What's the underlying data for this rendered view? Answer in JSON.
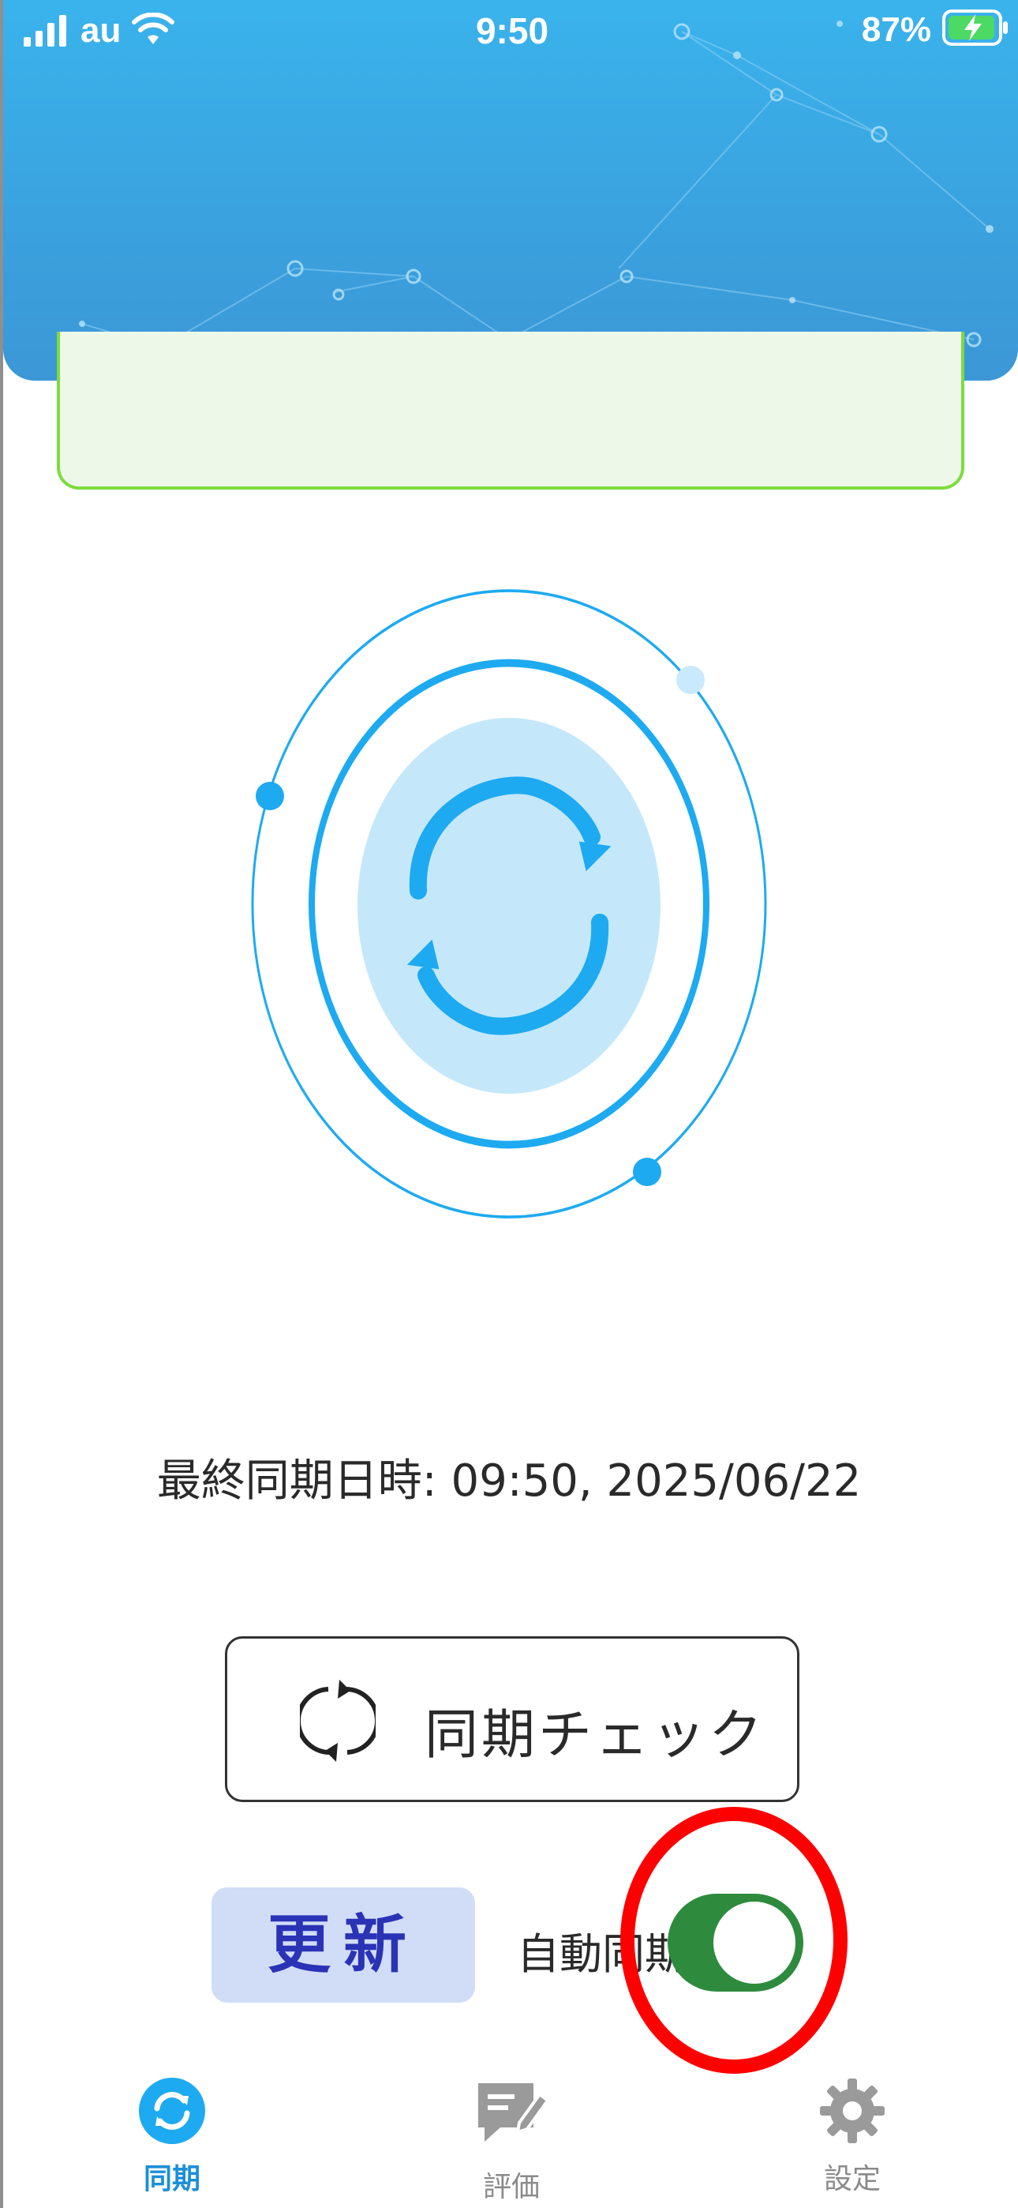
{
  "status_bar": {
    "carrier": "au",
    "time": "9:50",
    "battery_percent": "87%"
  },
  "sync": {
    "last_sync_text": "最終同期日時: 09:50, 2025/06/22",
    "check_button_label": "同期チェック",
    "refresh_button_label": "更新",
    "auto_sync_label": "自動同期",
    "auto_sync_enabled": true
  },
  "tabbar": {
    "items": [
      {
        "label": "同期",
        "icon": "sync-icon",
        "active": true
      },
      {
        "label": "評価",
        "icon": "rating-edit-icon",
        "active": false
      },
      {
        "label": "設定",
        "icon": "gear-icon",
        "active": false
      }
    ]
  },
  "colors": {
    "header_blue": "#3aa3df",
    "accent_blue": "#1eaaf0",
    "toggle_green": "#2e8b3e",
    "highlight_red": "#ff0000"
  }
}
